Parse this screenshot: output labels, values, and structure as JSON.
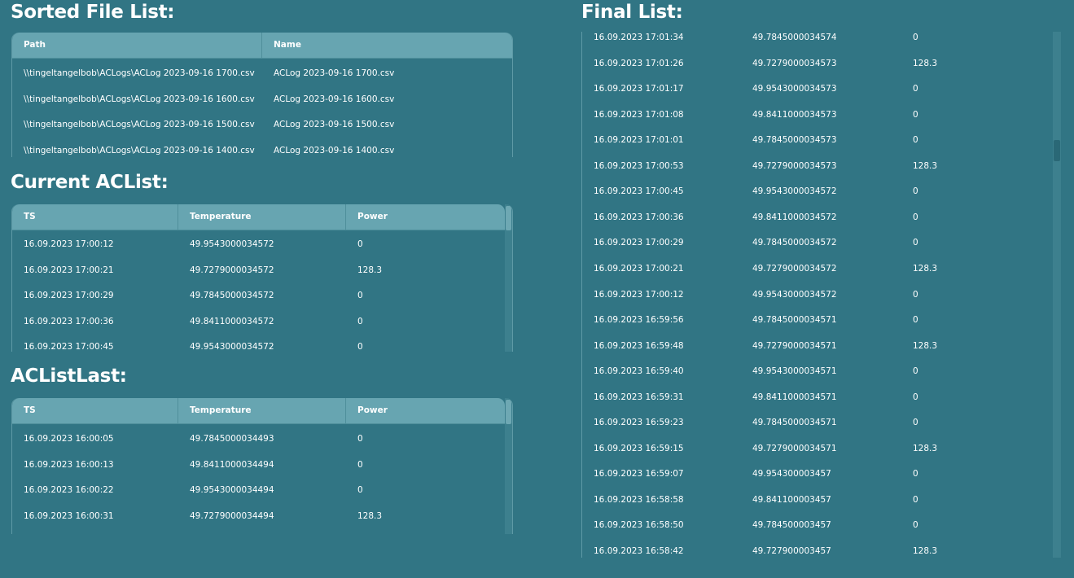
{
  "sorted_files": {
    "title": "Sorted File List:",
    "columns": [
      "Path",
      "Name"
    ],
    "rows": [
      [
        "\\\\tingeltangelbob\\ACLogs\\ACLog 2023-09-16 1700.csv",
        "ACLog 2023-09-16 1700.csv"
      ],
      [
        "\\\\tingeltangelbob\\ACLogs\\ACLog 2023-09-16 1600.csv",
        "ACLog 2023-09-16 1600.csv"
      ],
      [
        "\\\\tingeltangelbob\\ACLogs\\ACLog 2023-09-16 1500.csv",
        "ACLog 2023-09-16 1500.csv"
      ],
      [
        "\\\\tingeltangelbob\\ACLogs\\ACLog 2023-09-16 1400.csv",
        "ACLog 2023-09-16 1400.csv"
      ]
    ]
  },
  "current_aclist": {
    "title": "Current ACList:",
    "columns": [
      "TS",
      "Temperature",
      "Power"
    ],
    "rows": [
      [
        "16.09.2023 17:00:12",
        "49.9543000034572",
        "0"
      ],
      [
        "16.09.2023 17:00:21",
        "49.7279000034572",
        "128.3"
      ],
      [
        "16.09.2023 17:00:29",
        "49.7845000034572",
        "0"
      ],
      [
        "16.09.2023 17:00:36",
        "49.8411000034572",
        "0"
      ],
      [
        "16.09.2023 17:00:45",
        "49.9543000034572",
        "0"
      ]
    ]
  },
  "aclist_last": {
    "title": "ACListLast:",
    "columns": [
      "TS",
      "Temperature",
      "Power"
    ],
    "rows": [
      [
        "16.09.2023 16:00:05",
        "49.7845000034493",
        "0"
      ],
      [
        "16.09.2023 16:00:13",
        "49.8411000034494",
        "0"
      ],
      [
        "16.09.2023 16:00:22",
        "49.9543000034494",
        "0"
      ],
      [
        "16.09.2023 16:00:31",
        "49.7279000034494",
        "128.3"
      ]
    ]
  },
  "final_list": {
    "title": "Final List:",
    "rows": [
      [
        "16.09.2023 17:01:34",
        "49.7845000034574",
        "0"
      ],
      [
        "16.09.2023 17:01:26",
        "49.7279000034573",
        "128.3"
      ],
      [
        "16.09.2023 17:01:17",
        "49.9543000034573",
        "0"
      ],
      [
        "16.09.2023 17:01:08",
        "49.8411000034573",
        "0"
      ],
      [
        "16.09.2023 17:01:01",
        "49.7845000034573",
        "0"
      ],
      [
        "16.09.2023 17:00:53",
        "49.7279000034573",
        "128.3"
      ],
      [
        "16.09.2023 17:00:45",
        "49.9543000034572",
        "0"
      ],
      [
        "16.09.2023 17:00:36",
        "49.8411000034572",
        "0"
      ],
      [
        "16.09.2023 17:00:29",
        "49.7845000034572",
        "0"
      ],
      [
        "16.09.2023 17:00:21",
        "49.7279000034572",
        "128.3"
      ],
      [
        "16.09.2023 17:00:12",
        "49.9543000034572",
        "0"
      ],
      [
        "16.09.2023 16:59:56",
        "49.7845000034571",
        "0"
      ],
      [
        "16.09.2023 16:59:48",
        "49.7279000034571",
        "128.3"
      ],
      [
        "16.09.2023 16:59:40",
        "49.9543000034571",
        "0"
      ],
      [
        "16.09.2023 16:59:31",
        "49.8411000034571",
        "0"
      ],
      [
        "16.09.2023 16:59:23",
        "49.7845000034571",
        "0"
      ],
      [
        "16.09.2023 16:59:15",
        "49.7279000034571",
        "128.3"
      ],
      [
        "16.09.2023 16:59:07",
        "49.954300003457",
        "0"
      ],
      [
        "16.09.2023 16:58:58",
        "49.841100003457",
        "0"
      ],
      [
        "16.09.2023 16:58:50",
        "49.784500003457",
        "0"
      ],
      [
        "16.09.2023 16:58:42",
        "49.727900003457",
        "128.3"
      ]
    ]
  },
  "colors": {
    "background": "#317584",
    "header": "#67a5b1",
    "text": "#ffffff"
  }
}
